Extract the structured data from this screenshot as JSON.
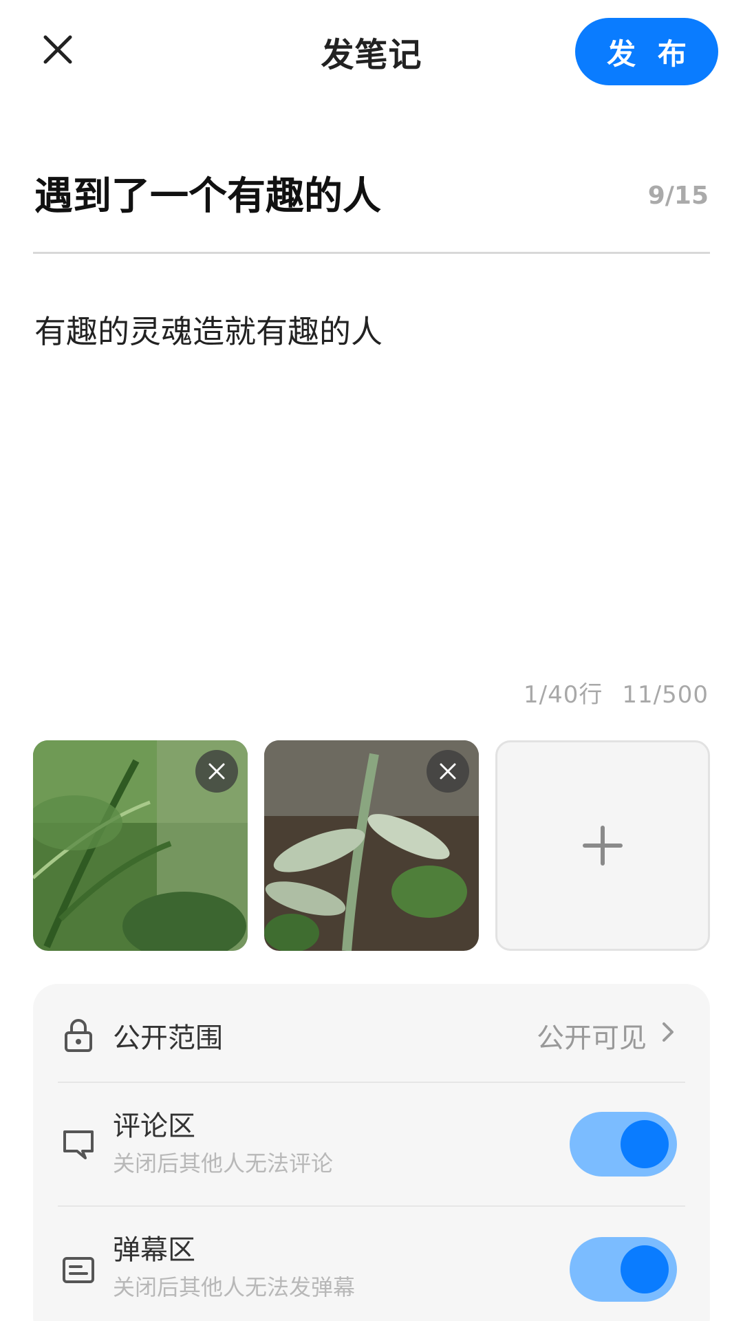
{
  "header": {
    "title": "发笔记",
    "publish_label": "发 布"
  },
  "note": {
    "title_value": "遇到了一个有趣的人",
    "title_count": "9/15",
    "body_value": "有趣的灵魂造就有趣的人",
    "line_count": "1/40行",
    "char_count": "11/500"
  },
  "images": [
    {
      "name": "fern plant photo"
    },
    {
      "name": "succulent plant photo"
    }
  ],
  "settings": {
    "visibility": {
      "label": "公开范围",
      "value": "公开可见",
      "icon": "lock-icon"
    },
    "comments": {
      "label": "评论区",
      "sub": "关闭后其他人无法评论",
      "enabled": true,
      "icon": "comment-icon"
    },
    "danmaku": {
      "label": "弹幕区",
      "sub": "关闭后其他人无法发弹幕",
      "enabled": true,
      "icon": "danmaku-icon"
    }
  },
  "colors": {
    "accent": "#0a7cff",
    "toggle_track": "#7bbcff",
    "muted_text": "#aaaaaa"
  }
}
